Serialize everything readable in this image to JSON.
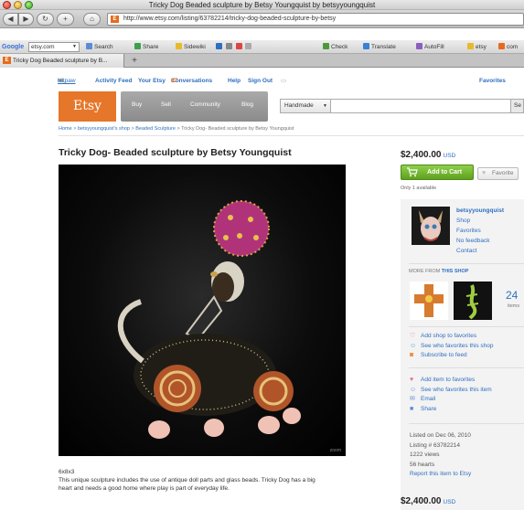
{
  "window": {
    "title": "Tricky Dog Beaded sculpture by Betsy Youngquist by betsyyoungquist",
    "url": "http://www.etsy.com/listing/63782214/tricky-dog-beaded-sculpture-by-betsy"
  },
  "google_toolbar": {
    "logo": "Google",
    "search_value": "etsy.com",
    "items": [
      "Search",
      "Share",
      "Sidewiki",
      "Check",
      "Translate",
      "AutoFill",
      "etsy",
      "com"
    ]
  },
  "tabs": [
    {
      "label": "Tricky Dog Beaded sculpture by B..."
    }
  ],
  "topnav": {
    "greeting": "Hi,",
    "username": "artpaw",
    "links": [
      "Activity Feed",
      "Your Etsy",
      "Conversations",
      "Help",
      "Sign Out"
    ],
    "conversations_count": "87",
    "favorites": "Favorites"
  },
  "header": {
    "logo": "Etsy",
    "nav": [
      "Buy",
      "Sell",
      "Community",
      "Blog"
    ],
    "search_category": "Handmade",
    "search_button": "Se"
  },
  "breadcrumb": {
    "items": [
      "Home",
      "betsyyoungquist's shop",
      "Beaded Sculpture"
    ],
    "current": "Tricky Dog- Beaded sculpture by Betsy Youngquist"
  },
  "listing": {
    "title": "Tricky Dog- Beaded sculpture by Betsy Youngquist",
    "price": "$2,400.00",
    "currency": "USD",
    "add_to_cart": "Add to Cart",
    "favorite": "Favorite",
    "availability": "Only 1 available",
    "dimensions": "6x8x3",
    "description": "This unique sculpture includes the use of antique doll parts and glass beads. Tricky Dog has a big heart and needs a good home where play is part of everyday life.",
    "photo_credit": "zoom"
  },
  "shop": {
    "name": "betsyyoungquist",
    "links": [
      "Shop",
      "Favorites",
      "No feedback",
      "Contact"
    ],
    "more_from_prefix": "MORE FROM",
    "more_from_link": "THIS SHOP",
    "item_count": "24",
    "item_count_label": "items"
  },
  "shop_actions": [
    "Add shop to favorites",
    "See who favorites this shop",
    "Subscribe to feed"
  ],
  "item_actions": [
    "Add item to favorites",
    "See who favorites this item",
    "Email",
    "Share"
  ],
  "meta": {
    "listed": "Listed on Dec 06, 2010",
    "listing_no": "Listing # 63782214",
    "views": "1222 views",
    "hearts": "56 hearts",
    "report": "Report this item to Etsy"
  },
  "colors": {
    "etsy_orange": "#e5762a",
    "link_blue": "#2f6fbf",
    "cart_green": "#6bb02a"
  }
}
